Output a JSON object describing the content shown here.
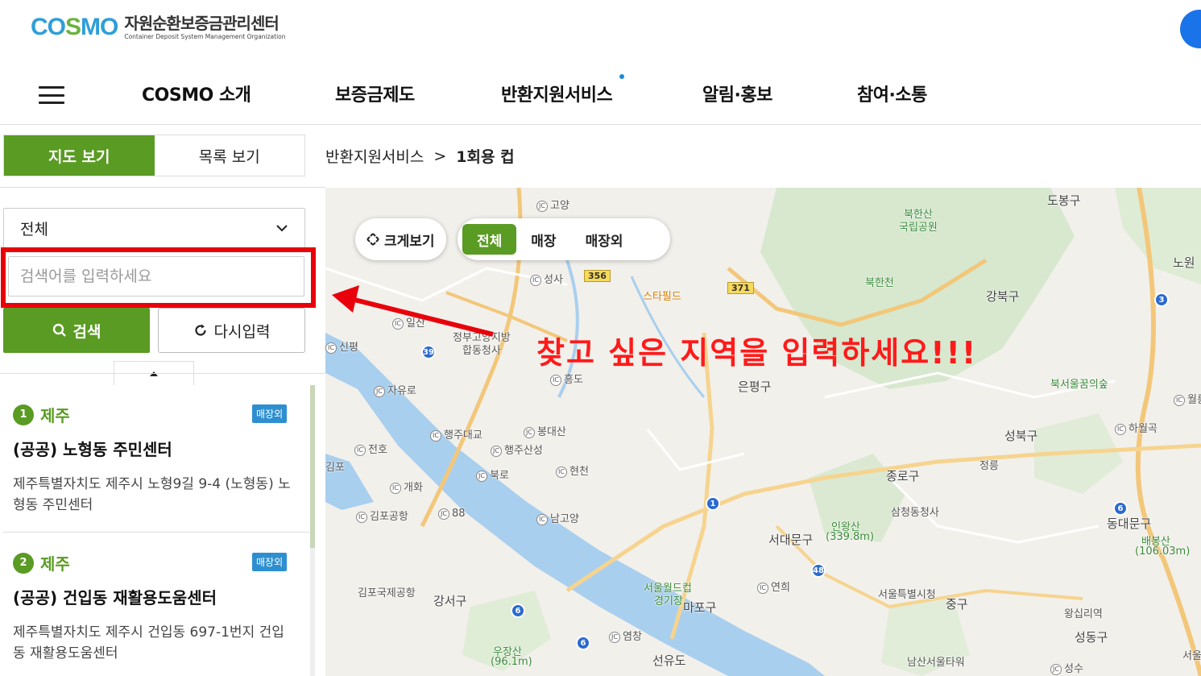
{
  "logo": {
    "mark": [
      "CO",
      "S",
      "MO"
    ],
    "name_ko": "자원순환보증금관리센터",
    "name_en": "Container Deposit System Management Organization"
  },
  "gnb": {
    "items": [
      "COSMO 소개",
      "보증금제도",
      "반환지원서비스",
      "알림·홍보",
      "참여·소통"
    ]
  },
  "view_toggle": {
    "map": "지도 보기",
    "list": "목록 보기"
  },
  "breadcrumb": {
    "parent": "반환지원서비스",
    "sep": ">",
    "current": "1회용 컵"
  },
  "search": {
    "select_value": "전체",
    "placeholder": "검색어를 입력하세요",
    "search_label": "검색",
    "reset_label": "다시입력"
  },
  "results": [
    {
      "num": "1",
      "region": "제주",
      "badge": "매장외",
      "name": "(공공) 노형동 주민센터",
      "address": "제주특별자치도 제주시 노형9길 9-4 (노형동) 노형동 주민센터"
    },
    {
      "num": "2",
      "region": "제주",
      "badge": "매장외",
      "name": "(공공) 건입동 재활용도움센터",
      "address": "제주특별자치도 제주시 건입동 697-1번지 건입동 재활용도움센터"
    }
  ],
  "map": {
    "enlarge_label": "크게보기",
    "filters": [
      "전체",
      "매장",
      "매장외"
    ],
    "overlay_text": "찾고 싶은 지역을 입력하세요!!!",
    "labels": {
      "dobong": "도봉구",
      "bukhansan": "북한산",
      "national_park": "국립공원",
      "bukhancheon": "북한천",
      "nowon": "노원",
      "gangbuk": "강북구",
      "starfield": "스타필드",
      "goyang": "고양",
      "seongsa": "성사",
      "hapdong1": "정부고양지방",
      "hapdong2": "합동청사",
      "sinpyeong": "신평",
      "ilsan": "일산",
      "eunpyeong": "은평구",
      "heungdo": "흥도",
      "jayuro": "자유로",
      "haengju": "행주대교",
      "bongdaesan": "봉대산",
      "haengjusanseong": "행주산성",
      "bukro": "북로",
      "hyeoncheon": "현천",
      "jeonho": "전호",
      "gaehwa": "개화",
      "gimpo_ap": "김포공항",
      "nangoyang": "남고양",
      "gimpo_intl": "김포국제공항",
      "gangseo": "강서구",
      "seodaemun": "서대문구",
      "jongno": "종로구",
      "seongbuk": "성북구",
      "jeongneung": "정릉",
      "samcheong": "삼청동청사",
      "inwangsan": "인왕산",
      "inwangsan_h": "(339.8m)",
      "hawolgok": "하월곡",
      "wolgye": "월릉",
      "bukseoul": "북서울꿈의숲",
      "dongdaemun": "동대문구",
      "baebongsan": "배봉산",
      "baebongsan_h": "(106.03m)",
      "wc_stadium1": "서울월드컵",
      "wc_stadium2": "경기장",
      "mapo": "마포구",
      "yeonhui": "연희",
      "seoul_cityhall": "서울특별시청",
      "junggu": "중구",
      "wangsimni": "왕십리역",
      "seongdong": "성동구",
      "woojangsan": "우장산",
      "woojangsan_h": "(96.1m)",
      "yeomchang": "염창",
      "seonyudo": "선유도",
      "namsan": "남산서울타워",
      "seongsu": "성수",
      "gimpo_left": "김포",
      "seoul_right": "서울",
      "hyeonjeon": "현천"
    },
    "routes": [
      "39",
      "356",
      "371",
      "1",
      "3",
      "6",
      "48",
      "6",
      "88",
      "6"
    ]
  },
  "colors": {
    "brand_green": "#5a9b23",
    "badge_blue": "#2d8fd0",
    "overlay_red": "#ff1a1a",
    "highlight_red": "#e8000b"
  }
}
